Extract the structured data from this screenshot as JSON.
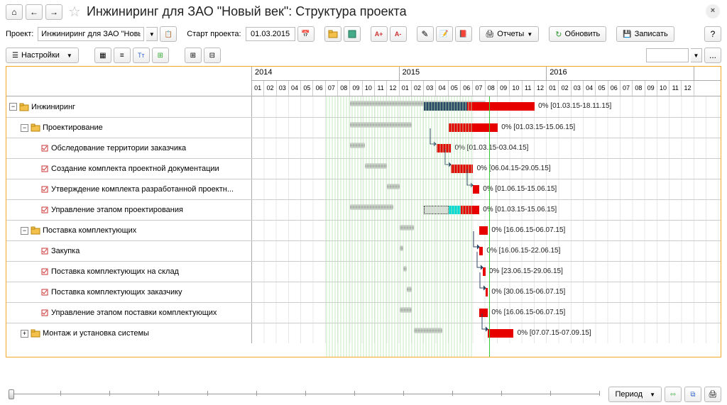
{
  "title": "Инжиниринг для ЗАО \"Новый век\": Структура проекта",
  "toolbar": {
    "project_label": "Проект:",
    "project_value": "Инжиниринг для ЗАО \"Новый",
    "start_label": "Старт проекта:",
    "start_value": "01.03.2015",
    "reports": "Отчеты",
    "refresh": "Обновить",
    "save": "Записать",
    "help": "?",
    "settings": "Настройки"
  },
  "timeline": {
    "years": [
      {
        "label": "2014",
        "months": 12
      },
      {
        "label": "2015",
        "months": 12
      },
      {
        "label": "2016",
        "months": 12
      }
    ],
    "months": [
      "01",
      "02",
      "03",
      "04",
      "05",
      "06",
      "07",
      "08",
      "09",
      "10",
      "11",
      "12"
    ]
  },
  "rows": [
    {
      "indent": 0,
      "type": "folder",
      "name": "Инжиниринг",
      "pm": "-",
      "baseline": [
        8,
        19
      ],
      "bars": [
        {
          "k": "navy",
          "s": 14,
          "e": 17.5
        },
        {
          "k": "red",
          "s": 17.5,
          "e": 23
        }
      ],
      "label": "0% [01.03.15-18.11.15]"
    },
    {
      "indent": 1,
      "type": "folder",
      "name": "Проектирование",
      "pm": "-",
      "baseline": [
        8,
        13
      ],
      "bars": [
        {
          "k": "red",
          "s": 16,
          "e": 20
        }
      ],
      "label": "0% [01.03.15-15.06.15]"
    },
    {
      "indent": 2,
      "type": "task",
      "name": "Обследование территории заказчика",
      "baseline": [
        8,
        9.2
      ],
      "bars": [
        {
          "k": "red",
          "s": 15,
          "e": 16.2
        }
      ],
      "label": "0% [01.03.15-03.04.15]",
      "arrow": true
    },
    {
      "indent": 2,
      "type": "task",
      "name": "Создание комплекта проектной документации",
      "baseline": [
        9.2,
        11
      ],
      "bars": [
        {
          "k": "red",
          "s": 16.2,
          "e": 18
        }
      ],
      "label": "0% [06.04.15-29.05.15]",
      "arrow": true
    },
    {
      "indent": 2,
      "type": "task",
      "name": "Утверждение комплекта разработанной проектн...",
      "baseline": [
        11,
        12
      ],
      "bars": [
        {
          "k": "red",
          "s": 18,
          "e": 18.5
        }
      ],
      "label": "0% [01.06.15-15.06.15]",
      "arrow": true
    },
    {
      "indent": 2,
      "type": "task",
      "name": "Управление этапом проектирования",
      "baseline": [
        8,
        11.5
      ],
      "bars": [
        {
          "k": "dotted",
          "s": 14,
          "e": 16
        },
        {
          "k": "cyan",
          "s": 16,
          "e": 17
        },
        {
          "k": "red",
          "s": 17,
          "e": 18.5
        }
      ],
      "label": "0% [01.03.15-15.06.15]"
    },
    {
      "indent": 1,
      "type": "folder",
      "name": "Поставка комплектующих",
      "pm": "-",
      "baseline": [
        12,
        13.2
      ],
      "bars": [
        {
          "k": "red",
          "s": 18.5,
          "e": 19.2
        }
      ],
      "label": "0% [16.06.15-06.07.15]"
    },
    {
      "indent": 2,
      "type": "task",
      "name": "Закупка",
      "baseline": [
        12,
        12.3
      ],
      "bars": [
        {
          "k": "red",
          "s": 18.5,
          "e": 18.8
        }
      ],
      "label": "0% [16.06.15-22.06.15]",
      "arrow": true
    },
    {
      "indent": 2,
      "type": "task",
      "name": "Поставка комплектующих на склад",
      "baseline": [
        12.3,
        12.6
      ],
      "bars": [
        {
          "k": "red",
          "s": 18.8,
          "e": 19
        }
      ],
      "label": "0% [23.06.15-29.06.15]",
      "arrow": true
    },
    {
      "indent": 2,
      "type": "task",
      "name": "Поставка комплектующих заказчику",
      "baseline": [
        12.6,
        13
      ],
      "bars": [
        {
          "k": "red",
          "s": 19,
          "e": 19.2
        }
      ],
      "label": "0% [30.06.15-06.07.15]",
      "arrow": true
    },
    {
      "indent": 2,
      "type": "task",
      "name": "Управление этапом поставки комплектующих",
      "baseline": [
        12,
        13
      ],
      "bars": [
        {
          "k": "red",
          "s": 18.5,
          "e": 19.2
        }
      ],
      "label": "0% [16.06.15-06.07.15]"
    },
    {
      "indent": 1,
      "type": "folder",
      "name": "Монтаж и установка системы",
      "pm": "+",
      "baseline": [
        13.2,
        15.5
      ],
      "bars": [
        {
          "k": "red",
          "s": 19.2,
          "e": 21.3
        }
      ],
      "label": "0% [07.07.15-07.09.15]",
      "arrow": true
    }
  ],
  "bottom": {
    "period": "Период"
  }
}
